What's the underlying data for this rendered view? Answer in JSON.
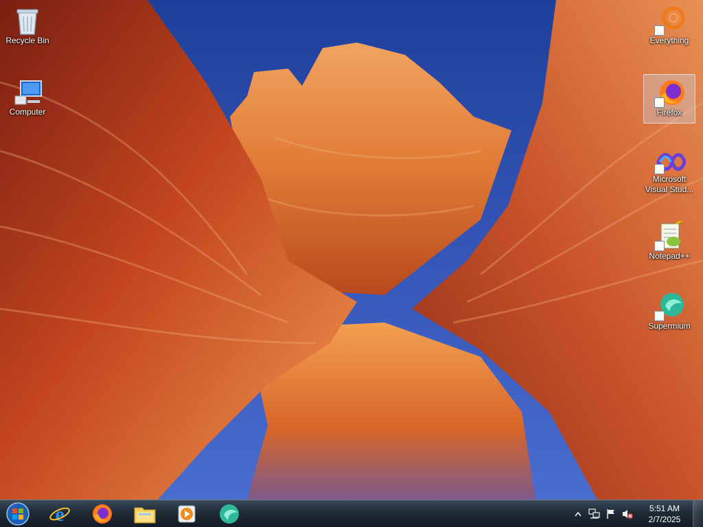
{
  "desktop": {
    "icons_left": [
      {
        "label": "Recycle Bin",
        "icon": "recycle-bin-icon"
      },
      {
        "label": "Computer",
        "icon": "computer-icon"
      }
    ],
    "icons_right": [
      {
        "label": "Everything",
        "icon": "everything-icon"
      },
      {
        "label": "Firefox",
        "icon": "firefox-icon",
        "selected": true
      },
      {
        "label": "Microsoft Visual Stud...",
        "icon": "visual-studio-icon"
      },
      {
        "label": "Notepad++",
        "icon": "notepad-plus-plus-icon"
      },
      {
        "label": "Supermium",
        "icon": "supermium-icon"
      }
    ]
  },
  "taskbar": {
    "start_icon": "windows-start-orb-icon",
    "pinned": [
      {
        "name": "Internet Explorer",
        "icon": "internet-explorer-icon"
      },
      {
        "name": "Firefox",
        "icon": "firefox-icon"
      },
      {
        "name": "Windows Explorer",
        "icon": "file-explorer-icon"
      },
      {
        "name": "Windows Media Player",
        "icon": "media-player-icon"
      },
      {
        "name": "Supermium",
        "icon": "supermium-icon"
      }
    ],
    "tray": {
      "icons": [
        "show-hidden-icons-arrow-icon",
        "network-icon",
        "action-center-flag-icon",
        "volume-muted-icon"
      ],
      "time": "5:51 AM",
      "date": "2/7/2025"
    }
  },
  "colors": {
    "taskbar_bg": "#1f2a36",
    "selection": "#c8dcf0"
  }
}
